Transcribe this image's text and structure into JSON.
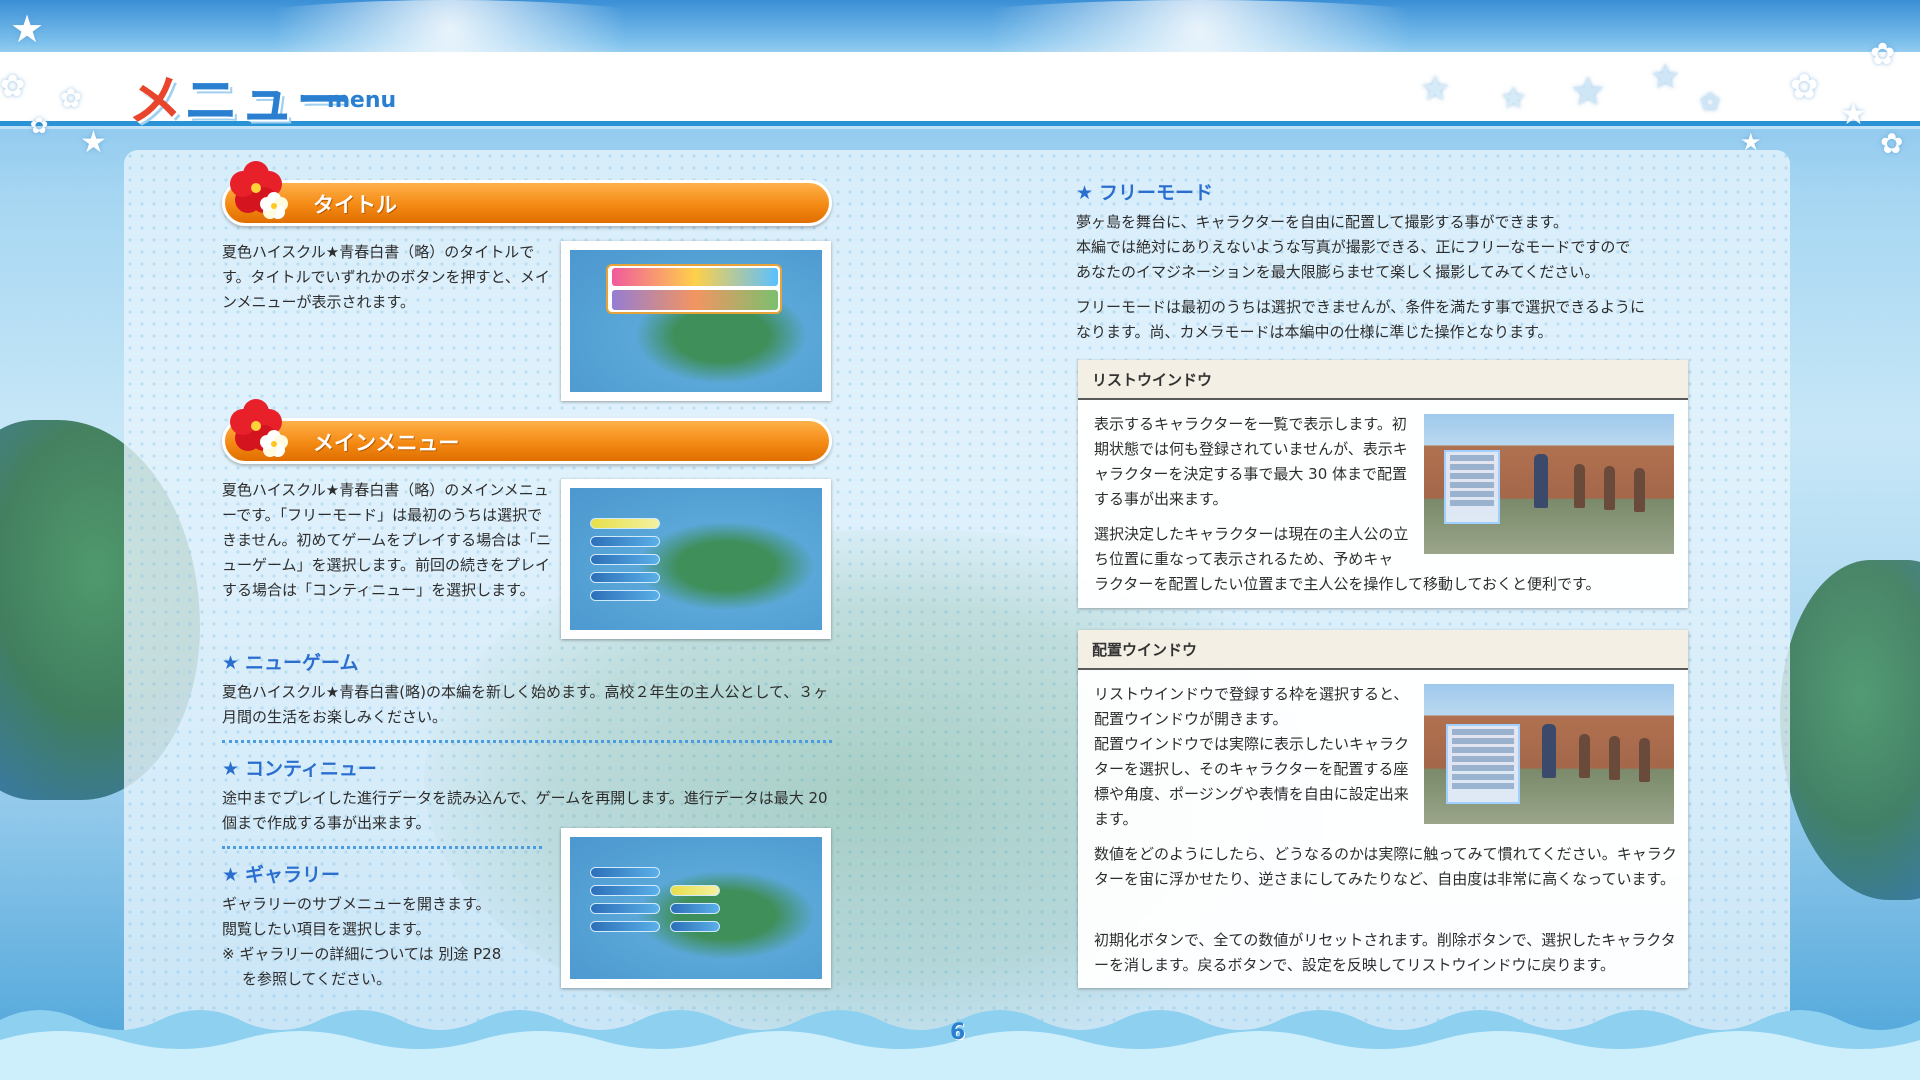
{
  "header": {
    "title": "メニュー",
    "subtitle": "menu"
  },
  "left": {
    "title_section": {
      "heading": "タイトル",
      "text": "夏色ハイスクル★青春白書（略）のタイトルです。タイトルでいずれかのボタンを押すと、メインメニューが表示されます。"
    },
    "main_menu_section": {
      "heading": "メインメニュー",
      "text": "夏色ハイスクル★青春白書（略）のメインメニューです。「フリーモード」は最初のうちは選択できません。初めてゲームをプレイする場合は「ニューゲーム」を選択します。前回の続きをプレイする場合は「コンティニュー」を選択します。"
    },
    "new_game": {
      "heading": "ニューゲーム",
      "text": "夏色ハイスクル★青春白書(略)の本編を新しく始めます。高校２年生の主人公として、３ヶ月間の生活をお楽しみください。"
    },
    "continue": {
      "heading": "コンティニュー",
      "text": "途中までプレイした進行データを読み込んで、ゲームを再開します。進行データは最大 20 個まで作成する事が出来ます。"
    },
    "gallery": {
      "heading": "ギャラリー",
      "line1": "ギャラリーのサブメニューを開きます。",
      "line2": "閲覧したい項目を選択します。",
      "note1": "※ ギャラリーの詳細については 別途 P28",
      "note2": "を参照してください。"
    }
  },
  "right": {
    "free_mode": {
      "heading": "フリーモード",
      "para1_line1": "夢ヶ島を舞台に、キャラクターを自由に配置して撮影する事ができます。",
      "para1_line2": "本編では絶対にありえないような写真が撮影できる、正にフリーなモードですので",
      "para1_line3": "あなたのイマジネーションを最大限膨らませて楽しく撮影してみてください。",
      "para2_line1": "フリーモードは最初のうちは選択できませんが、条件を満たす事で選択できるように",
      "para2_line2": "なります。尚、カメラモードは本編中の仕様に準じた操作となります。"
    },
    "list_window": {
      "title": "リストウインドウ",
      "para1": "表示するキャラクターを一覧で表示します。初期状態では何も登録されていませんが、表示キャラクターを決定する事で最大 30 体まで配置する事が出来ます。",
      "para2a": "選択決定したキャラクターは現在の主人公の立ち位置に重なって表示されるため、予めキャ",
      "para2b": "ラクターを配置したい位置まで主人公を操作して移動しておくと便利です。"
    },
    "placement_window": {
      "title": "配置ウインドウ",
      "para1": "リストウインドウで登録する枠を選択すると、配置ウインドウが開きます。",
      "para2": "配置ウインドウでは実際に表示したいキャラクターを選択し、そのキャラクターを配置する座標や角度、ポージングや表情を自由に設定出来ます。",
      "para3": "数値をどのようにしたら、どうなるのかは実際に触ってみて慣れてください。キャラクターを宙に浮かせたり、逆さまにしてみたりなど、自由度は非常に高くなっています。",
      "para4": "初期化ボタンで、全ての数値がリセットされます。削除ボタンで、選択したキャラクターを消します。戻るボタンで、設定を反映してリストウインドウに戻ります。"
    }
  },
  "page_number": "6",
  "colors": {
    "accent_orange": "#f48a14",
    "accent_blue": "#2a6fcf",
    "title_red": "#e8452c"
  },
  "icons": [
    "hibiscus-icon",
    "star-icon"
  ]
}
